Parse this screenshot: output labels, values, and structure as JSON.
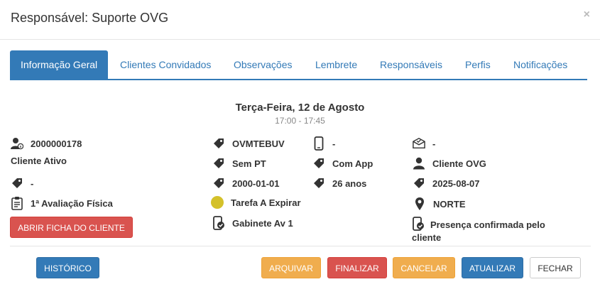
{
  "header": {
    "title": "Responsável: Suporte OVG",
    "close_label": "×"
  },
  "tabs": [
    {
      "label": "Informação Geral",
      "active": true
    },
    {
      "label": "Clientes Convidados"
    },
    {
      "label": "Observações"
    },
    {
      "label": "Lembrete"
    },
    {
      "label": "Responsáveis"
    },
    {
      "label": "Perfis"
    },
    {
      "label": "Notificações"
    }
  ],
  "event": {
    "date": "Terça-Feira, 12 de Agosto",
    "time": "17:00 - 17:45"
  },
  "col1": {
    "client_id": "2000000178",
    "client_status": "Cliente Ativo",
    "tag_value": "-",
    "assessment": "1ª Avaliação Física",
    "open_file_button": "ABRIR FICHA DO CLIENTE"
  },
  "col2": {
    "code": "OVMTEBUV",
    "pt": "Sem PT",
    "birth_date": "2000-01-01",
    "task_status": "Tarefa A Expirar",
    "room": "Gabinete Av 1"
  },
  "col3": {
    "phone": "-",
    "app": "Com App",
    "age": "26 anos"
  },
  "col4": {
    "email": "-",
    "client_type": "Cliente OVG",
    "date": "2025-08-07",
    "region": "NORTE",
    "presence": "Presença confirmada pelo cliente"
  },
  "footer": {
    "history": "HISTÓRICO",
    "archive": "ARQUIVAR",
    "finish": "FINALIZAR",
    "cancel": "CANCELAR",
    "update": "ATUALIZAR",
    "close": "FECHAR"
  },
  "colors": {
    "primary": "#337ab7",
    "danger": "#d9534f",
    "warning": "#f0ad4e",
    "status_dot": "#d4c12a"
  }
}
